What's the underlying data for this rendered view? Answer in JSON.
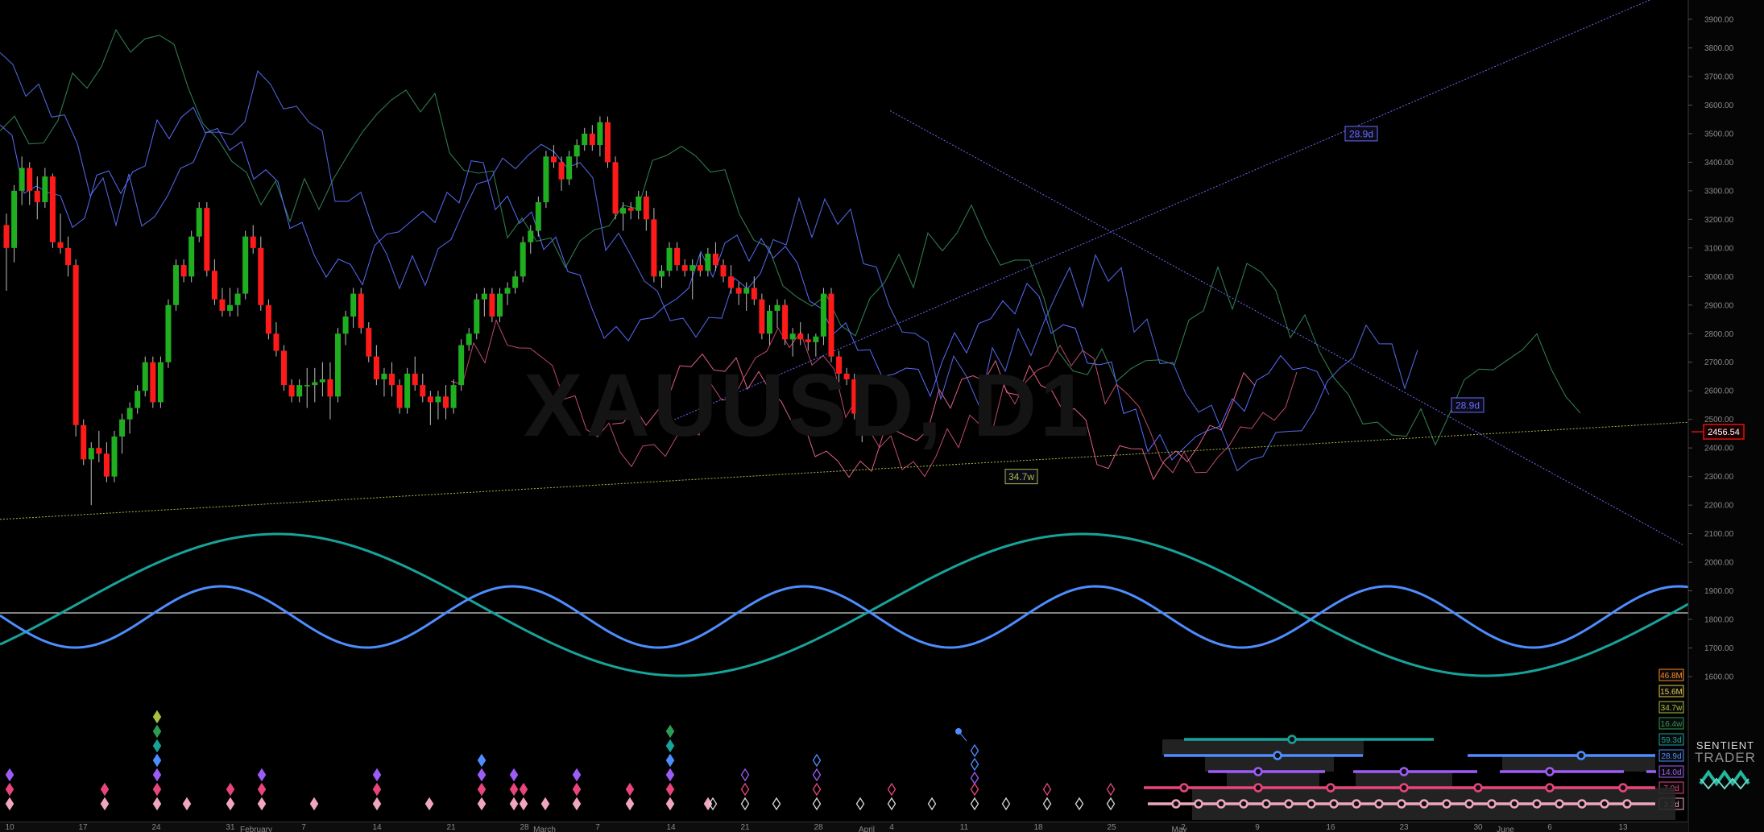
{
  "symbol_watermark": "XAUUSD, D1",
  "brand": {
    "line1": "SENTIENT",
    "line2": "TRADER"
  },
  "current_price": "2456.54",
  "colors": {
    "background": "#000000",
    "bull_candle": "#1fae1f",
    "bear_candle": "#ff1a1a",
    "trendline": "#6b6bff",
    "support_line": "#a8b84a",
    "teal_wave": "#17a39a",
    "blue_wave": "#4e8dff",
    "price_box": "#e01010"
  },
  "chart_data": {
    "type": "candlestick",
    "y_axis": {
      "min": 1600,
      "max": 3900,
      "ticks": [
        3900,
        3800,
        3700,
        3600,
        3500,
        3400,
        3300,
        3200,
        3100,
        3000,
        2900,
        2800,
        2700,
        2600,
        2500,
        2400,
        2300,
        2200,
        2100,
        2000,
        1900,
        1800,
        1700,
        1600
      ]
    },
    "x_axis_ticks": [
      "10",
      "17",
      "24",
      "31",
      "7",
      "14",
      "21",
      "28",
      "7",
      "14",
      "21",
      "28",
      "4",
      "11",
      "18",
      "25",
      "2",
      "9",
      "16",
      "23",
      "30",
      "6",
      "13"
    ],
    "month_labels": [
      "February",
      "March",
      "April",
      "May",
      "June"
    ],
    "candles": [
      [
        3180,
        3220,
        2950,
        3100
      ],
      [
        3100,
        3320,
        3050,
        3300
      ],
      [
        3300,
        3420,
        3250,
        3380
      ],
      [
        3380,
        3400,
        3250,
        3300
      ],
      [
        3300,
        3350,
        3200,
        3260
      ],
      [
        3260,
        3380,
        3240,
        3350
      ],
      [
        3350,
        3360,
        3100,
        3120
      ],
      [
        3120,
        3220,
        3080,
        3100
      ],
      [
        3100,
        3140,
        3000,
        3040
      ],
      [
        3040,
        3060,
        2440,
        2480
      ],
      [
        2480,
        2500,
        2340,
        2360
      ],
      [
        2360,
        2420,
        2200,
        2400
      ],
      [
        2400,
        2460,
        2350,
        2380
      ],
      [
        2380,
        2420,
        2280,
        2300
      ],
      [
        2300,
        2460,
        2280,
        2440
      ],
      [
        2440,
        2520,
        2380,
        2500
      ],
      [
        2500,
        2560,
        2450,
        2540
      ],
      [
        2540,
        2620,
        2520,
        2600
      ],
      [
        2600,
        2720,
        2580,
        2700
      ],
      [
        2700,
        2720,
        2540,
        2560
      ],
      [
        2560,
        2720,
        2540,
        2700
      ],
      [
        2700,
        2920,
        2680,
        2900
      ],
      [
        2900,
        3060,
        2880,
        3040
      ],
      [
        3040,
        3060,
        2980,
        3000
      ],
      [
        3000,
        3160,
        2980,
        3140
      ],
      [
        3140,
        3260,
        3120,
        3240
      ],
      [
        3240,
        3260,
        3000,
        3020
      ],
      [
        3020,
        3060,
        2900,
        2920
      ],
      [
        2920,
        2960,
        2860,
        2880
      ],
      [
        2880,
        2960,
        2860,
        2900
      ],
      [
        2900,
        2960,
        2860,
        2940
      ],
      [
        2940,
        3160,
        2920,
        3140
      ],
      [
        3140,
        3180,
        3080,
        3100
      ],
      [
        3100,
        3140,
        2880,
        2900
      ],
      [
        2900,
        2920,
        2780,
        2800
      ],
      [
        2800,
        2840,
        2720,
        2740
      ],
      [
        2740,
        2760,
        2600,
        2620
      ],
      [
        2620,
        2640,
        2560,
        2580
      ],
      [
        2580,
        2640,
        2560,
        2620
      ],
      [
        2620,
        2680,
        2540,
        2620
      ],
      [
        2620,
        2680,
        2560,
        2630
      ],
      [
        2630,
        2700,
        2580,
        2640
      ],
      [
        2640,
        2700,
        2500,
        2580
      ],
      [
        2580,
        2820,
        2560,
        2800
      ],
      [
        2800,
        2880,
        2760,
        2860
      ],
      [
        2860,
        2960,
        2820,
        2940
      ],
      [
        2940,
        2960,
        2800,
        2820
      ],
      [
        2820,
        2840,
        2700,
        2720
      ],
      [
        2720,
        2760,
        2620,
        2640
      ],
      [
        2640,
        2680,
        2580,
        2660
      ],
      [
        2660,
        2700,
        2580,
        2620
      ],
      [
        2620,
        2640,
        2520,
        2540
      ],
      [
        2540,
        2680,
        2520,
        2660
      ],
      [
        2660,
        2720,
        2600,
        2620
      ],
      [
        2620,
        2660,
        2560,
        2580
      ],
      [
        2580,
        2600,
        2480,
        2560
      ],
      [
        2560,
        2600,
        2500,
        2580
      ],
      [
        2580,
        2620,
        2500,
        2540
      ],
      [
        2540,
        2640,
        2520,
        2620
      ],
      [
        2620,
        2780,
        2600,
        2760
      ],
      [
        2760,
        2820,
        2740,
        2800
      ],
      [
        2800,
        2940,
        2780,
        2920
      ],
      [
        2920,
        2960,
        2860,
        2940
      ],
      [
        2940,
        2960,
        2840,
        2860
      ],
      [
        2860,
        2960,
        2840,
        2940
      ],
      [
        2940,
        2980,
        2900,
        2960
      ],
      [
        2960,
        3020,
        2940,
        3000
      ],
      [
        3000,
        3140,
        2980,
        3120
      ],
      [
        3120,
        3180,
        3080,
        3160
      ],
      [
        3160,
        3280,
        3140,
        3260
      ],
      [
        3260,
        3440,
        3240,
        3420
      ],
      [
        3420,
        3460,
        3380,
        3400
      ],
      [
        3400,
        3420,
        3300,
        3340
      ],
      [
        3340,
        3440,
        3320,
        3420
      ],
      [
        3420,
        3480,
        3380,
        3460
      ],
      [
        3460,
        3520,
        3440,
        3500
      ],
      [
        3500,
        3530,
        3440,
        3460
      ],
      [
        3460,
        3560,
        3420,
        3540
      ],
      [
        3540,
        3560,
        3380,
        3400
      ],
      [
        3400,
        3420,
        3200,
        3220
      ],
      [
        3220,
        3260,
        3160,
        3240
      ],
      [
        3240,
        3260,
        3200,
        3230
      ],
      [
        3230,
        3300,
        3200,
        3280
      ],
      [
        3280,
        3300,
        3160,
        3200
      ],
      [
        3200,
        3240,
        2980,
        3000
      ],
      [
        3000,
        3040,
        2960,
        3020
      ],
      [
        3020,
        3120,
        3000,
        3100
      ],
      [
        3100,
        3120,
        3020,
        3040
      ],
      [
        3040,
        3060,
        3000,
        3020
      ],
      [
        3020,
        3060,
        2920,
        3040
      ],
      [
        3040,
        3080,
        3000,
        3020
      ],
      [
        3020,
        3100,
        3000,
        3080
      ],
      [
        3080,
        3120,
        3020,
        3040
      ],
      [
        3040,
        3060,
        2980,
        3000
      ],
      [
        3000,
        3040,
        2940,
        2960
      ],
      [
        2960,
        2980,
        2900,
        2940
      ],
      [
        2940,
        2980,
        2880,
        2960
      ],
      [
        2960,
        3000,
        2900,
        2920
      ],
      [
        2920,
        2940,
        2780,
        2800
      ],
      [
        2800,
        2900,
        2760,
        2880
      ],
      [
        2880,
        2920,
        2820,
        2900
      ],
      [
        2900,
        2920,
        2760,
        2780
      ],
      [
        2780,
        2820,
        2720,
        2800
      ],
      [
        2800,
        2840,
        2760,
        2780
      ],
      [
        2780,
        2800,
        2740,
        2770
      ],
      [
        2770,
        2800,
        2720,
        2790
      ],
      [
        2790,
        2960,
        2760,
        2940
      ],
      [
        2940,
        2960,
        2700,
        2720
      ],
      [
        2720,
        2740,
        2620,
        2660
      ],
      [
        2660,
        2680,
        2620,
        2640
      ],
      [
        2640,
        2660,
        2500,
        2520
      ],
      [
        2520,
        2540,
        2420,
        2456.54
      ]
    ],
    "cycle_line_labels": [
      "28.9d",
      "28.9d",
      "34.7w"
    ],
    "timeline_labels": [
      {
        "label": "46.8M",
        "color": "#ff8c2a"
      },
      {
        "label": "15.6M",
        "color": "#e0c84a"
      },
      {
        "label": "34.7w",
        "color": "#a8c040"
      },
      {
        "label": "16.4w",
        "color": "#2f9a55"
      },
      {
        "label": "59.3d",
        "color": "#17a39a"
      },
      {
        "label": "28.9d",
        "color": "#4e8dff"
      },
      {
        "label": "14.0d",
        "color": "#9c5cf5"
      },
      {
        "label": "7.0d",
        "color": "#e8457a"
      },
      {
        "label": "3.2d",
        "color": "#f0a6c0"
      }
    ]
  }
}
